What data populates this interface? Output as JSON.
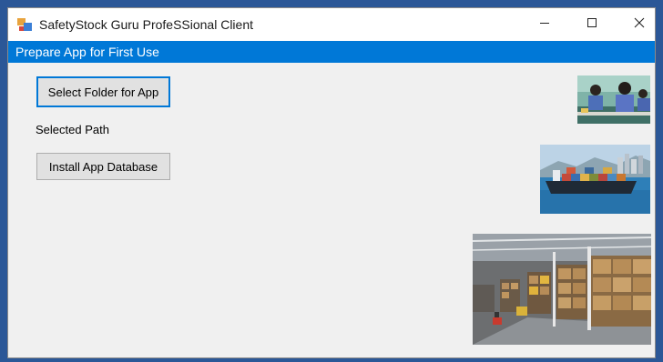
{
  "window": {
    "title": "SafetyStock Guru ProfeSSional Client",
    "app_icon": "app-window-icon",
    "controls": {
      "minimize_icon": "minimize-icon",
      "maximize_icon": "maximize-icon",
      "close_icon": "close-icon"
    }
  },
  "header": {
    "text": "Prepare App for First Use",
    "color": "#0078d7"
  },
  "main": {
    "select_folder_button": "Select Folder for App",
    "selected_path_label": "Selected Path",
    "install_database_button": "Install App Database"
  },
  "images": [
    {
      "subject": "factory-workers-photo"
    },
    {
      "subject": "cargo-ship-photo"
    },
    {
      "subject": "warehouse-photo"
    }
  ]
}
